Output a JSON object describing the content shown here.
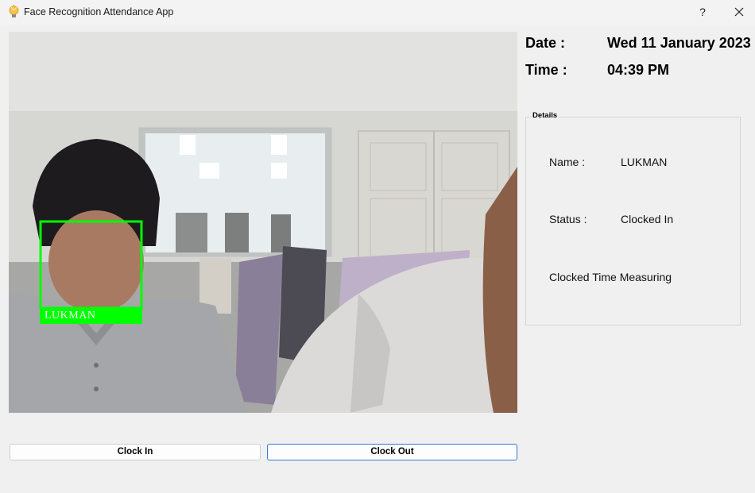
{
  "window": {
    "title": "Face Recognition Attendance App",
    "help_label": "?",
    "icon": "lightbulb-icon"
  },
  "camera": {
    "face_label": "LUKMAN",
    "box_color": "#00ff00"
  },
  "info": {
    "date_label": "Date :",
    "date_value": "Wed 11 January 2023",
    "time_label": "Time :",
    "time_value": "04:39 PM"
  },
  "details": {
    "group_title": "Details",
    "name_label": "Name :",
    "name_value": "LUKMAN",
    "status_label": "Status :",
    "status_value": "Clocked In",
    "clocked_time_text": "Clocked Time Measuring"
  },
  "buttons": {
    "clock_in": "Clock In",
    "clock_out": "Clock Out"
  },
  "colors": {
    "accent": "#2f7bd6",
    "background": "#f0f0f0"
  }
}
